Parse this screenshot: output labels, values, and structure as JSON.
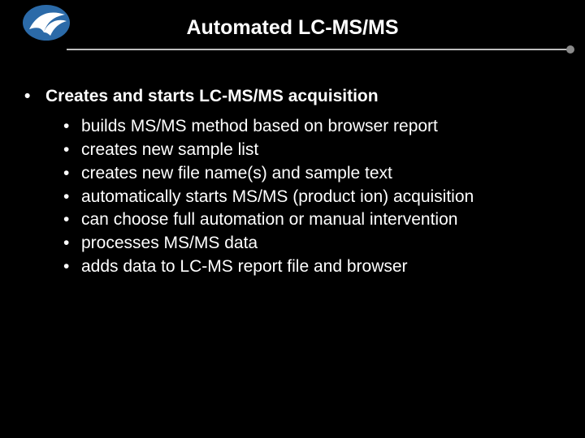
{
  "slide": {
    "title": "Automated LC-MS/MS",
    "topBullet": "Creates and starts LC-MS/MS acquisition",
    "subs": [
      "builds MS/MS method based on browser report",
      "creates new sample list",
      "creates new file name(s) and sample text",
      "automatically starts MS/MS (product ion) acquisition",
      "can choose full automation or manual intervention",
      "processes MS/MS data",
      "adds data to LC-MS report file and browser"
    ]
  }
}
